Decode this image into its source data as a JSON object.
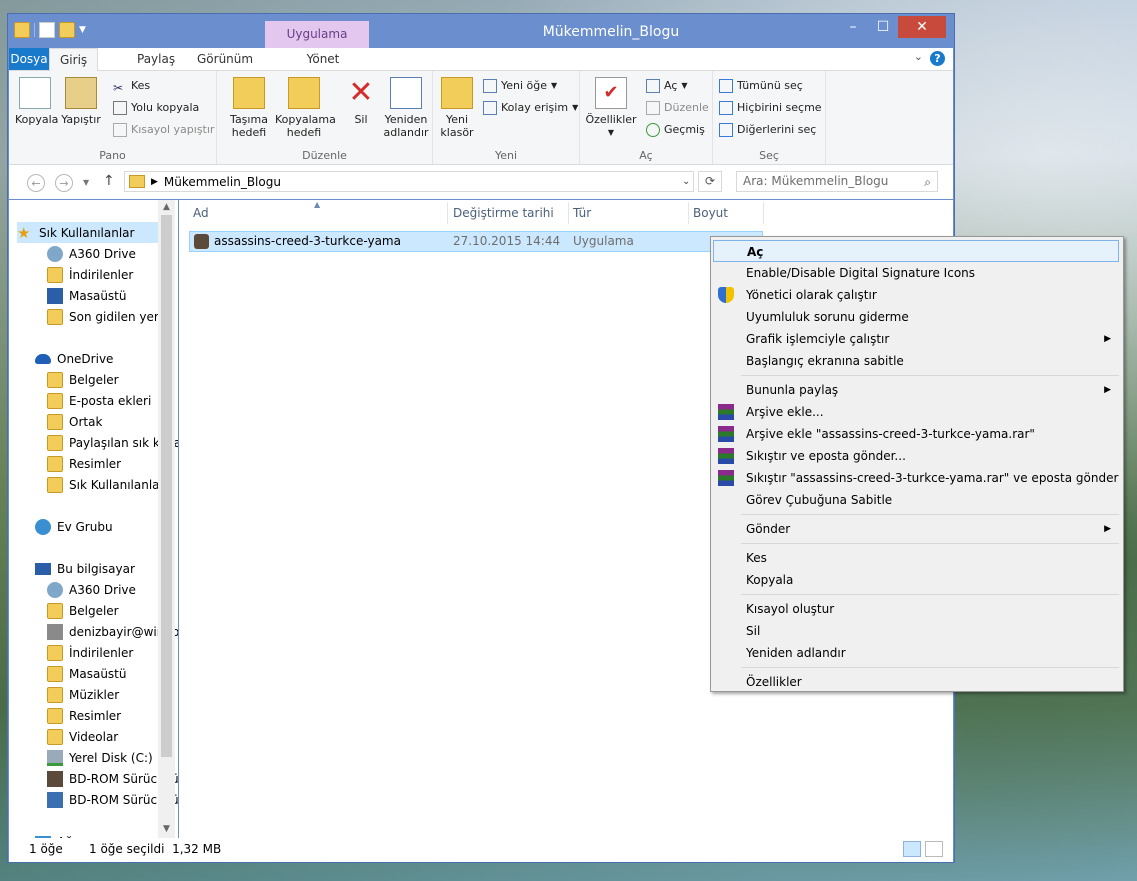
{
  "window": {
    "title": "Mükemmelin_Blogu",
    "context_tab_group": "Uygulama Araçları",
    "controls": {
      "minimize": "–",
      "maximize": "☐",
      "close": "✕"
    }
  },
  "tabs": {
    "file": "Dosya",
    "home": "Giriş",
    "share": "Paylaş",
    "view": "Görünüm",
    "manage": "Yönet"
  },
  "help": "?",
  "ribbon": {
    "clipboard": {
      "label": "Pano",
      "copy": "Kopyala",
      "paste": "Yapıştır",
      "cut": "Kes",
      "copy_path": "Yolu kopyala",
      "paste_shortcut": "Kısayol yapıştır"
    },
    "organize": {
      "label": "Düzenle",
      "move_to_1": "Taşıma",
      "move_to_2": "hedefi",
      "copy_to_1": "Kopyalama",
      "copy_to_2": "hedefi",
      "delete": "Sil",
      "rename_1": "Yeniden",
      "rename_2": "adlandır"
    },
    "new": {
      "label": "Yeni",
      "new_folder_1": "Yeni",
      "new_folder_2": "klasör",
      "new_item": "Yeni öğe",
      "easy_access": "Kolay erişim"
    },
    "open": {
      "label": "Aç",
      "properties": "Özellikler",
      "open": "Aç",
      "edit": "Düzenle",
      "history": "Geçmiş"
    },
    "select": {
      "label": "Seç",
      "select_all": "Tümünü seç",
      "select_none": "Hiçbirini seçme",
      "invert": "Diğerlerini seç"
    }
  },
  "address": {
    "path": "Mükemmelin_Blogu",
    "search_placeholder": "Ara: Mükemmelin_Blogu"
  },
  "nav": {
    "favorites": "Sık Kullanılanlar",
    "fav_items": [
      "A360 Drive",
      "İndirilenler",
      "Masaüstü",
      "Son gidilen yerler"
    ],
    "onedrive": "OneDrive",
    "onedrive_items": [
      "Belgeler",
      "E-posta ekleri",
      "Ortak",
      "Paylaşılan sık kullanılanlar",
      "Resimler",
      "Sık Kullanılanlar"
    ],
    "homegroup": "Ev Grubu",
    "thispc": "Bu bilgisayar",
    "pc_items": [
      "A360 Drive",
      "Belgeler",
      "denizbayir@windowslive.com",
      "İndirilenler",
      "Masaüstü",
      "Müzikler",
      "Resimler",
      "Videolar",
      "Yerel Disk (C:)",
      "BD-ROM Sürücüsü",
      "BD-ROM Sürücüsü"
    ],
    "network": "Ağ"
  },
  "columns": {
    "name": "Ad",
    "date": "Değiştirme tarihi",
    "type": "Tür",
    "size": "Boyut"
  },
  "file": {
    "name": "assassins-creed-3-turkce-yama",
    "date": "27.10.2015 14:44",
    "type": "Uygulama"
  },
  "status": {
    "count": "1 öğe",
    "selected": "1 öğe seçildi  1,32 MB"
  },
  "context_menu": {
    "open": "Aç",
    "sig_icons": "Enable/Disable Digital Signature Icons",
    "run_admin": "Yönetici olarak çalıştır",
    "troubleshoot": "Uyumluluk sorunu giderme",
    "run_gpu": "Grafik işlemciyle çalıştır",
    "pin_start": "Başlangıç ekranına sabitle",
    "share_with": "Bununla paylaş",
    "add_archive": "Arşive ekle...",
    "add_archive_rar": "Arşive ekle \"assassins-creed-3-turkce-yama.rar\"",
    "compress_email": "Sıkıştır ve eposta gönder...",
    "compress_rar_email": "Sıkıştır \"assassins-creed-3-turkce-yama.rar\" ve eposta gönder",
    "pin_taskbar": "Görev Çubuğuna Sabitle",
    "send_to": "Gönder",
    "cut": "Kes",
    "copy": "Kopyala",
    "create_shortcut": "Kısayol oluştur",
    "delete": "Sil",
    "rename": "Yeniden adlandır",
    "properties": "Özellikler"
  }
}
